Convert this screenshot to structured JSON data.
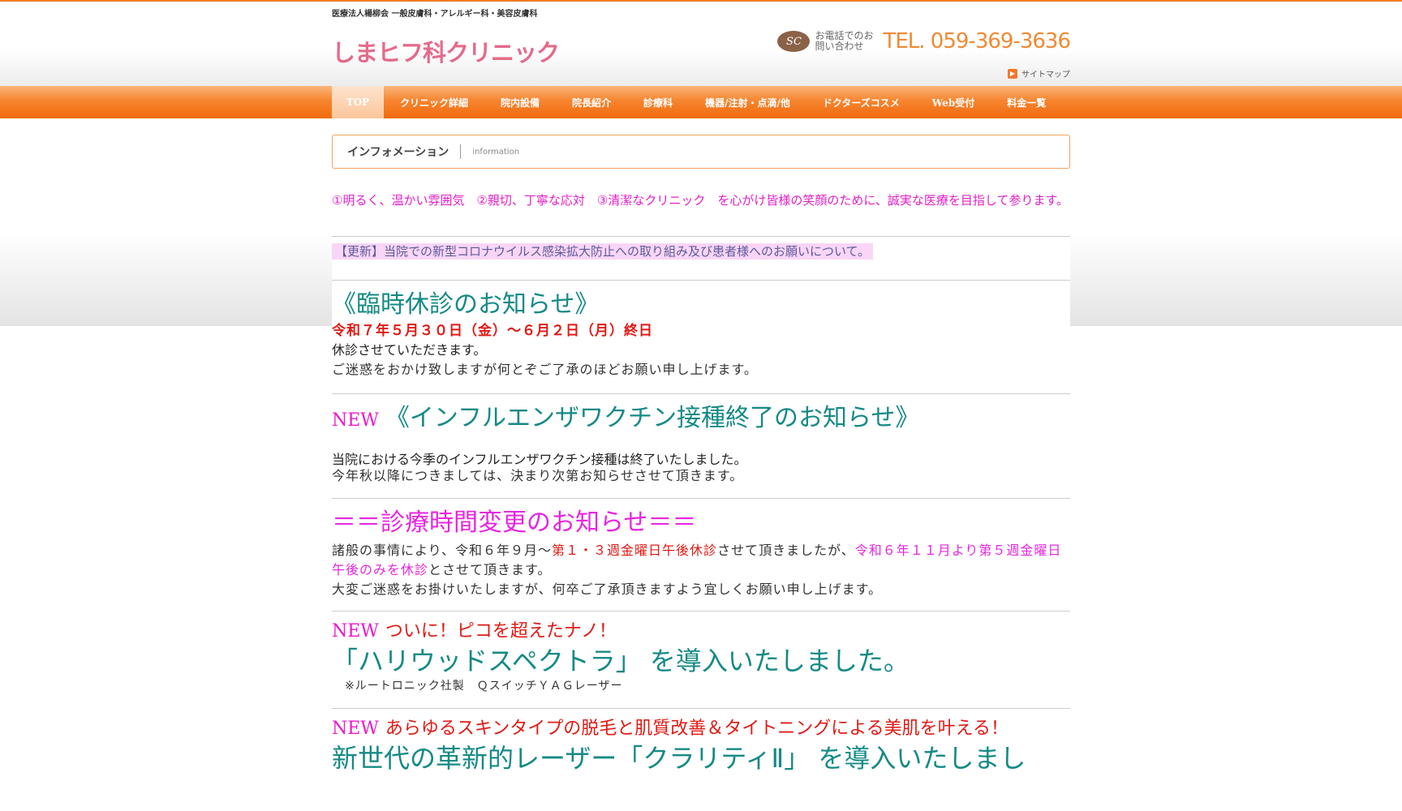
{
  "header": {
    "corporate_line": "医療法人楊柳会 一般皮膚科・アレルギー科・美容皮膚科",
    "logo_text": "しまヒフ科クリニック",
    "phone_badge": "SC",
    "phone_label": "お電話でのお問い合わせ",
    "phone_number": "TEL. 059-369-3636",
    "sitemap_label": "サイトマップ"
  },
  "nav": {
    "items": [
      {
        "label": "TOP"
      },
      {
        "label": "クリニック詳細"
      },
      {
        "label": "院内設備"
      },
      {
        "label": "院長紹介"
      },
      {
        "label": "診療科"
      },
      {
        "label": "機器/注射・点滴/他"
      },
      {
        "label": "ドクターズコスメ"
      },
      {
        "label": "Web受付"
      },
      {
        "label": "料金一覧"
      }
    ]
  },
  "info_bar": {
    "title_jp": "インフォメーション",
    "title_en": "information"
  },
  "intro": "①明るく、温かい雰囲気　②親切、丁寧な応対　③清潔なクリニック　を心がけ皆様の笑顔のために、誠実な医療を目指して参ります。",
  "update_link": "【更新】当院での新型コロナウイルス感染拡大防止への取り組み及び患者様へのお願いについて。",
  "closure": {
    "heading": "《臨時休診のお知らせ》",
    "dates": "令和７年５月３０日（金）～６月２日（月）終日",
    "line1": "休診させていただきます。",
    "line2": "ご迷惑をおかけ致しますが何とぞご了承のほどお願い申し上げます。"
  },
  "flu": {
    "new_label": "NEW",
    "heading": "《インフルエンザワクチン接種終了のお知らせ》",
    "line1": "当院における今季のインフルエンザワクチン接種は終了いたしました。",
    "line2": "今年秋以降につきましては、決まり次第お知らせさせて頂きます。"
  },
  "hours": {
    "heading": "＝＝診療時間変更のお知らせ＝＝",
    "p1_a": "諸般の事情により、令和６年９月～",
    "p1_b": "第１・３週金曜日午後休診",
    "p1_c": "させて頂きましたが、",
    "p1_d": "令和６年１１月より第５週金曜日午後のみを休診",
    "p1_e": "とさせて頂きます。",
    "p2": "大変ご迷惑をお掛けいたしますが、何卒ご了承頂きますよう宜しくお願い申し上げます。"
  },
  "spectra": {
    "new_label": "NEW",
    "tagline": "ついに！ピコを超えたナノ！",
    "heading": "「ハリウッドスペクトラ」 を導入いたしました。",
    "note": "※ルートロニック社製　ＱスイッチＹＡＧレーザー"
  },
  "clarity": {
    "new_label": "NEW",
    "tagline": "あらゆるスキンタイプの脱毛と肌質改善＆タイトニングによる美肌を叶える！",
    "heading": "新世代の革新的レーザー「クラリティⅡ」 を導入いたしまし"
  }
}
